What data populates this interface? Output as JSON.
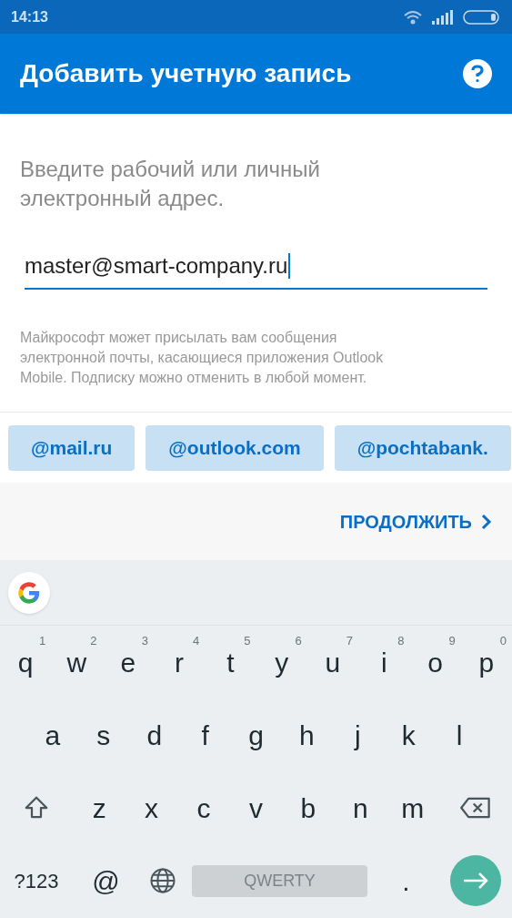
{
  "status_bar": {
    "time": "14:13"
  },
  "app_bar": {
    "title": "Добавить учетную запись"
  },
  "prompt": "Введите рабочий или личный электронный адрес.",
  "email_field": {
    "value": "master@smart-company.ru",
    "focused": true
  },
  "disclaimer_lines": [
    "Майкрософт может присылать вам сообщения",
    "электронной почты, касающиеся приложения Outlook",
    "Mobile. Подписку можно отменить в любой момент."
  ],
  "suggestions": [
    "@mail.ru",
    "@outlook.com",
    "@pochtabank."
  ],
  "continue_button": {
    "label": "ПРОДОЛЖИТЬ"
  },
  "keyboard": {
    "letter_rows": [
      [
        {
          "kind": "letter",
          "label": "q",
          "hint": "1"
        },
        {
          "kind": "letter",
          "label": "w",
          "hint": "2"
        },
        {
          "kind": "letter",
          "label": "e",
          "hint": "3"
        },
        {
          "kind": "letter",
          "label": "r",
          "hint": "4"
        },
        {
          "kind": "letter",
          "label": "t",
          "hint": "5"
        },
        {
          "kind": "letter",
          "label": "y",
          "hint": "6"
        },
        {
          "kind": "letter",
          "label": "u",
          "hint": "7"
        },
        {
          "kind": "letter",
          "label": "i",
          "hint": "8"
        },
        {
          "kind": "letter",
          "label": "o",
          "hint": "9"
        },
        {
          "kind": "letter",
          "label": "p",
          "hint": "0"
        }
      ],
      [
        {
          "kind": "letter",
          "label": "a"
        },
        {
          "kind": "letter",
          "label": "s"
        },
        {
          "kind": "letter",
          "label": "d"
        },
        {
          "kind": "letter",
          "label": "f"
        },
        {
          "kind": "letter",
          "label": "g"
        },
        {
          "kind": "letter",
          "label": "h"
        },
        {
          "kind": "letter",
          "label": "j"
        },
        {
          "kind": "letter",
          "label": "k"
        },
        {
          "kind": "letter",
          "label": "l"
        }
      ],
      [
        {
          "kind": "shift"
        },
        {
          "kind": "letter",
          "label": "z"
        },
        {
          "kind": "letter",
          "label": "x"
        },
        {
          "kind": "letter",
          "label": "c"
        },
        {
          "kind": "letter",
          "label": "v"
        },
        {
          "kind": "letter",
          "label": "b"
        },
        {
          "kind": "letter",
          "label": "n"
        },
        {
          "kind": "letter",
          "label": "m"
        },
        {
          "kind": "backspace"
        }
      ]
    ],
    "bottom_row": [
      {
        "kind": "symbols",
        "label": "?123"
      },
      {
        "kind": "letter",
        "label": "@"
      },
      {
        "kind": "globe"
      },
      {
        "kind": "space",
        "label": "QWERTY"
      },
      {
        "kind": "letter",
        "label": "."
      },
      {
        "kind": "enter"
      }
    ]
  }
}
